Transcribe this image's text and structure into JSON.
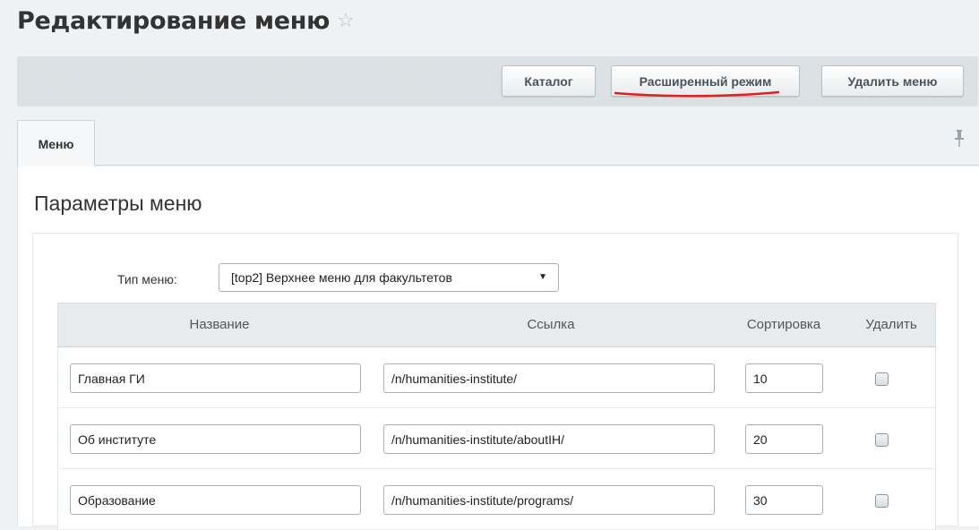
{
  "header": {
    "title": "Редактирование меню",
    "star_icon": "star-outline-icon"
  },
  "toolbar": {
    "catalog_label": "Каталог",
    "advanced_label": "Расширенный режим",
    "delete_label": "Удалить меню",
    "annotation_color": "#e02020"
  },
  "tabs": [
    {
      "label": "Меню",
      "active": true
    }
  ],
  "pin_icon": "pin-icon",
  "section": {
    "title": "Параметры меню"
  },
  "menu_type": {
    "label": "Тип меню:",
    "selected": "[top2] Верхнее меню для факультетов"
  },
  "table": {
    "columns": [
      "Название",
      "Ссылка",
      "Сортировка",
      "Удалить"
    ],
    "rows": [
      {
        "name": "Главная ГИ",
        "link": "/n/humanities-institute/",
        "sort": "10",
        "delete": false
      },
      {
        "name": "Об институте",
        "link": "/n/humanities-institute/aboutIH/",
        "sort": "20",
        "delete": false
      },
      {
        "name": "Образование",
        "link": "/n/humanities-institute/programs/",
        "sort": "30",
        "delete": false
      }
    ]
  },
  "colors": {
    "background": "#eef2f4",
    "toolbar": "#d9dfe2",
    "panel": "#ffffff",
    "table_header": "#e7ebed"
  }
}
